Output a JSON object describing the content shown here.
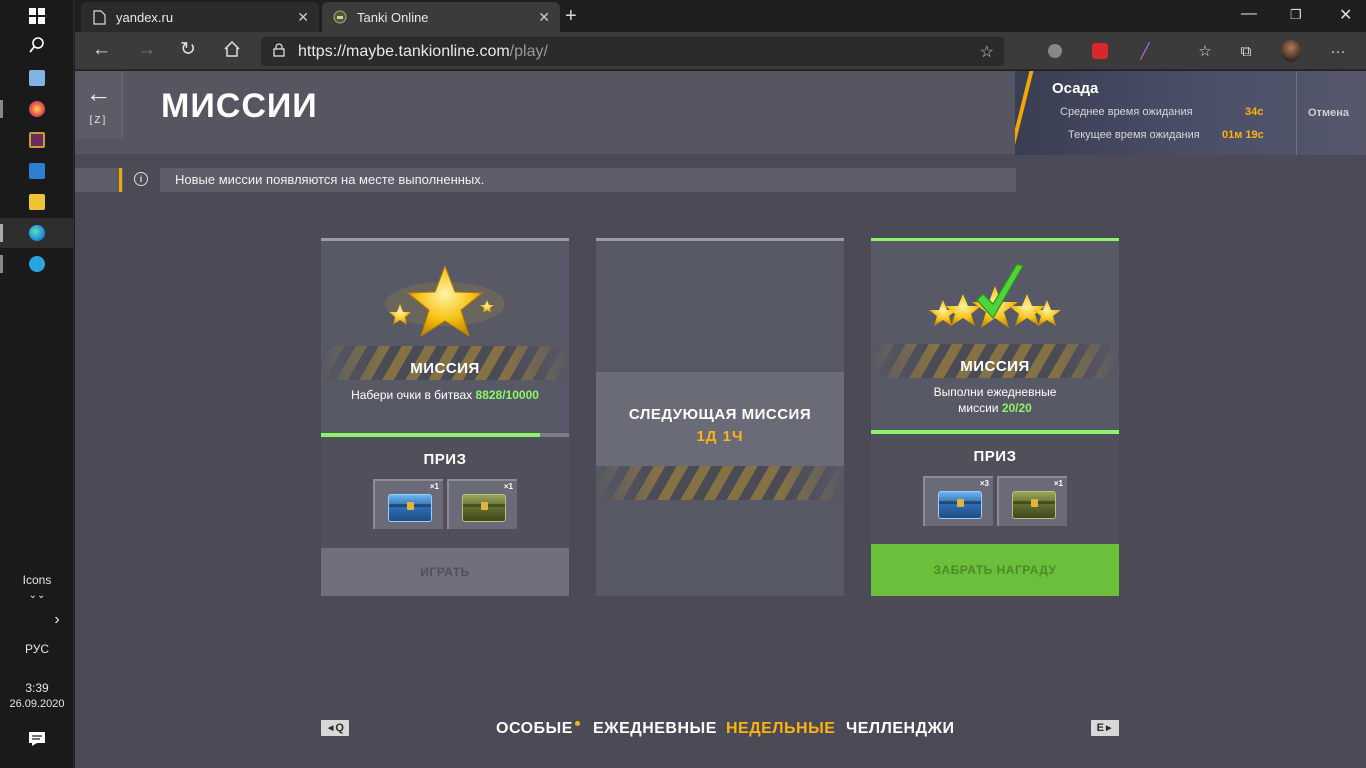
{
  "taskbar": {
    "icons": [
      "windows-icon",
      "search-icon",
      "notepad-icon",
      "paint-icon",
      "media-icon",
      "remote-desktop-icon",
      "file-explorer-icon",
      "edge-icon",
      "telegram-icon"
    ],
    "icons_label": "Icons",
    "chevron": "»",
    "language": "РУС",
    "time": "3:39",
    "date": "26.09.2020"
  },
  "browser": {
    "tabs": [
      {
        "title": "yandex.ru",
        "active": false
      },
      {
        "title": "Tanki Online",
        "active": true
      }
    ],
    "url_host": "https://maybe.tankionline.com",
    "url_path": "/play/"
  },
  "game": {
    "back_key": "[Z]",
    "page_title": "МИССИИ",
    "queue": {
      "mode": "Осада",
      "avg_label": "Среднее время ожидания",
      "avg_value": "34с",
      "cur_label": "Текущее время ожидания",
      "cur_value": "01м 19с",
      "cancel_label": "Отмена"
    },
    "info_text": "Новые миссии появляются на месте выполненных.",
    "cards": [
      {
        "title": "МИССИЯ",
        "desc": "Набери очки в битвах",
        "progress_text": "8828/10000",
        "progress": 0.8828,
        "prize_title": "ПРИЗ",
        "prizes": [
          {
            "type": "blue-container",
            "count": "×1"
          },
          {
            "type": "green-container",
            "count": "×1"
          }
        ],
        "button": "ИГРАТЬ"
      },
      {
        "next_title": "СЛЕДУЮЩАЯ МИССИЯ",
        "next_time": "1Д 1Ч"
      },
      {
        "title": "МИССИЯ",
        "desc_line1": "Выполни ежедневные",
        "desc_line2": "миссии",
        "progress_text": "20/20",
        "progress": 1.0,
        "prize_title": "ПРИЗ",
        "prizes": [
          {
            "type": "blue-container",
            "count": "×3"
          },
          {
            "type": "green-container",
            "count": "×1"
          }
        ],
        "button": "ЗАБРАТЬ НАГРАДУ"
      }
    ],
    "bottom_tabs": [
      {
        "label": "ОСОБЫЕ",
        "selected": false,
        "has_dot": true
      },
      {
        "label": "ЕЖЕДНЕВНЫЕ",
        "selected": false,
        "has_dot": false
      },
      {
        "label": "НЕДЕЛЬНЫЕ",
        "selected": true,
        "has_dot": false
      },
      {
        "label": "ЧЕЛЛЕНДЖИ",
        "selected": false,
        "has_dot": false
      }
    ],
    "key_prev": "Q",
    "key_next": "E"
  },
  "colors": {
    "accent": "#ffb20f",
    "progress_green": "#8cf56a",
    "claim_button": "#6bbf3a",
    "background": "#4a4b57"
  }
}
